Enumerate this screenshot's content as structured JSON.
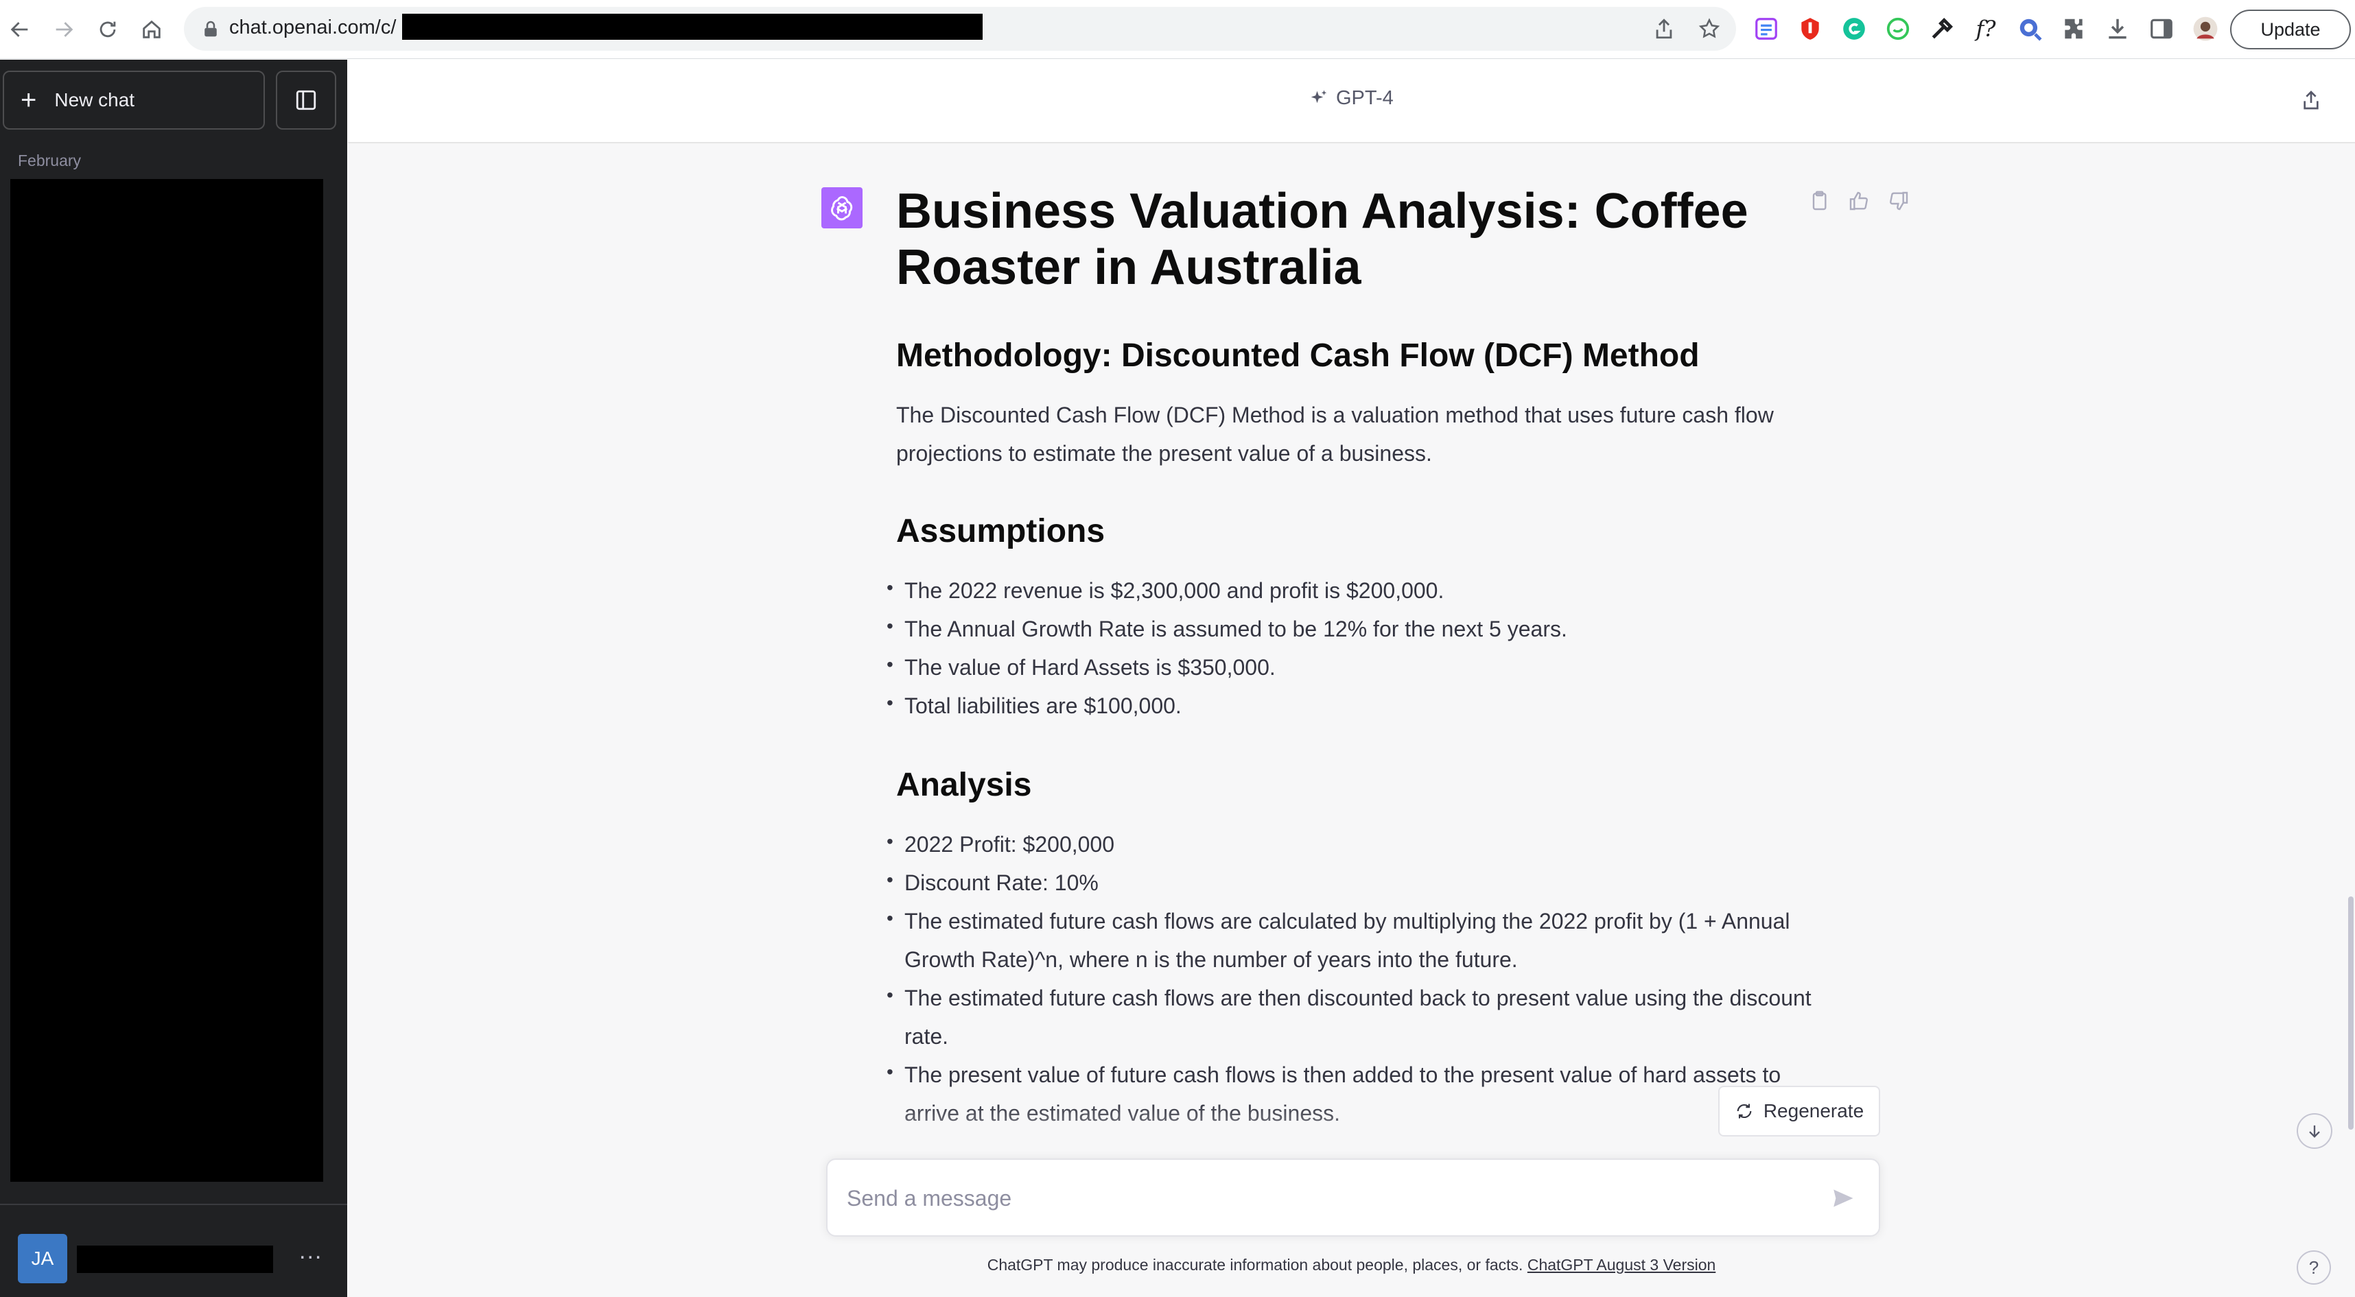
{
  "browser": {
    "url": "chat.openai.com/c/",
    "update_label": "Update",
    "extension_f_label": "f?"
  },
  "sidebar": {
    "new_chat_label": "New chat",
    "section_label": "February",
    "user_initials": "JA",
    "user_menu_label": "..."
  },
  "header": {
    "model_label": "GPT-4"
  },
  "message": {
    "title": "Business Valuation Analysis: Coffee Roaster in Australia",
    "methodology_heading": "Methodology: Discounted Cash Flow (DCF) Method",
    "methodology_text": "The Discounted Cash Flow (DCF) Method is a valuation method that uses future cash flow projections to estimate the present value of a business.",
    "assumptions_heading": "Assumptions",
    "assumptions": [
      "The 2022 revenue is $2,300,000 and profit is $200,000.",
      "The Annual Growth Rate is assumed to be 12% for the next 5 years.",
      "The value of Hard Assets is $350,000.",
      "Total liabilities are $100,000."
    ],
    "analysis_heading": "Analysis",
    "analysis": [
      "2022 Profit: $200,000",
      "Discount Rate: 10%",
      "The estimated future cash flows are calculated by multiplying the 2022 profit by (1 + Annual Growth Rate)^n, where n is the number of years into the future.",
      "The estimated future cash flows are then discounted back to present value using the discount rate.",
      "The present value of future cash flows is then added to the present value of hard assets to arrive at the estimated value of the business."
    ]
  },
  "composer": {
    "regenerate_label": "Regenerate",
    "placeholder": "Send a message",
    "disclaimer": "ChatGPT may produce inaccurate information about people, places, or facts.",
    "version_link": "ChatGPT August 3 Version",
    "help_label": "?"
  },
  "colors": {
    "sidebar_bg": "#202123",
    "main_bg": "#f7f7f8",
    "gpt4_avatar": "#ab68ff",
    "user_avatar": "#3b78c4"
  }
}
